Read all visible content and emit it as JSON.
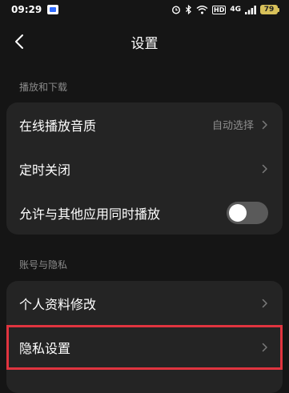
{
  "status_bar": {
    "time": "09:29",
    "hd_label": "HD",
    "network_label": "4G",
    "battery_level": "79"
  },
  "nav": {
    "title": "设置"
  },
  "sections": [
    {
      "header": "播放和下载",
      "items": [
        {
          "label": "在线播放音质",
          "value": "自动选择",
          "type": "link"
        },
        {
          "label": "定时关闭",
          "type": "link"
        },
        {
          "label": "允许与其他应用同时播放",
          "type": "toggle",
          "enabled": false
        }
      ]
    },
    {
      "header": "账号与隐私",
      "items": [
        {
          "label": "个人资料修改",
          "type": "link"
        },
        {
          "label": "隐私设置",
          "type": "link",
          "highlighted": true
        }
      ]
    }
  ],
  "colors": {
    "background": "#151515",
    "card": "#242424",
    "highlight": "#e0343f",
    "battery": "#d8c15a"
  }
}
